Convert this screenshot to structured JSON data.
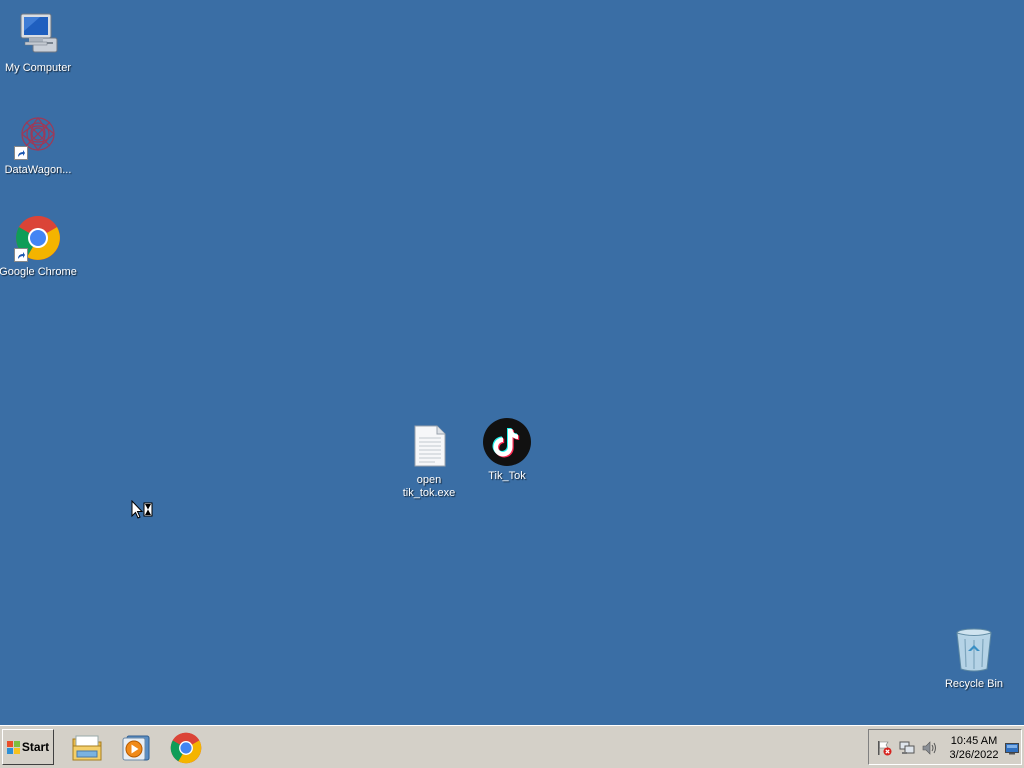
{
  "desktop": {
    "background_color": "#3a6ea5",
    "icons": {
      "my_computer": {
        "label": "My Computer",
        "icon": "computer-icon"
      },
      "datawagon": {
        "label": "DataWagon...",
        "icon": "datawagon-icon",
        "shortcut": true
      },
      "chrome": {
        "label": "Google Chrome",
        "icon": "chrome-icon",
        "shortcut": true
      },
      "open_tiktok": {
        "label": "open\ntik_tok.exe",
        "icon": "text-file-icon"
      },
      "tiktok": {
        "label": "Tik_Tok",
        "icon": "tiktok-icon"
      },
      "recycle_bin": {
        "label": "Recycle Bin",
        "icon": "recycle-bin-icon"
      }
    }
  },
  "taskbar": {
    "start_label": "Start",
    "quick_launch": [
      "file-explorer-icon",
      "media-player-icon",
      "chrome-icon"
    ],
    "tray": {
      "icons": [
        "action-center-icon",
        "network-icon",
        "volume-icon"
      ],
      "time": "10:45 AM",
      "date": "3/26/2022"
    }
  }
}
